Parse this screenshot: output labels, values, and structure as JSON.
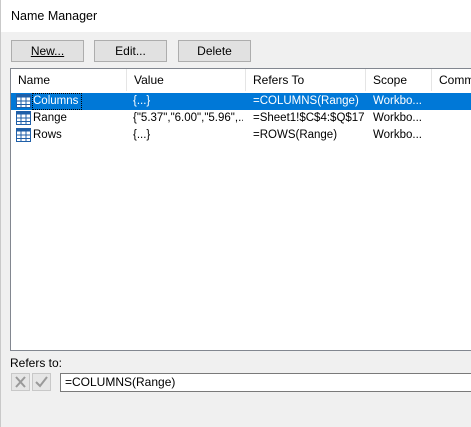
{
  "window": {
    "title": "Name Manager"
  },
  "toolbar": {
    "new_label": "New...",
    "edit_label": "Edit...",
    "delete_label": "Delete"
  },
  "columns": [
    "Name",
    "Value",
    "Refers To",
    "Scope",
    "Comm"
  ],
  "rows": [
    {
      "name": "Columns",
      "value": "{...}",
      "refers_to": "=COLUMNS(Range)",
      "scope": "Workbo...",
      "comment": "",
      "selected": true,
      "icon": "table-grid-icon"
    },
    {
      "name": "Range",
      "value": "{\"5.37\",\"6.00\",\"5.96\",...",
      "refers_to": "=Sheet1!$C$4:$Q$17",
      "scope": "Workbo...",
      "comment": "",
      "selected": false,
      "icon": "table-grid-icon"
    },
    {
      "name": "Rows",
      "value": "{...}",
      "refers_to": "=ROWS(Range)",
      "scope": "Workbo...",
      "comment": "",
      "selected": false,
      "icon": "table-grid-icon"
    }
  ],
  "refers_to": {
    "label": "Refers to:",
    "value": "=COLUMNS(Range)",
    "cancel_icon": "cancel-x-icon",
    "confirm_icon": "checkmark-icon"
  },
  "colors": {
    "selection": "#0078d7",
    "dialog_bg": "#f0f0f0",
    "icon_blue": "#1f5fa8"
  }
}
